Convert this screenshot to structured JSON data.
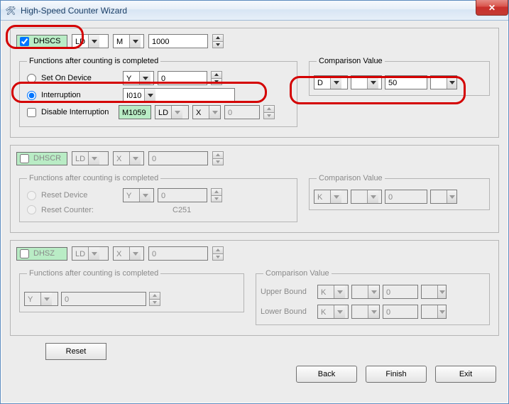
{
  "window": {
    "title": "High-Speed Counter Wizard",
    "close_glyph": "✕"
  },
  "buttons": {
    "reset": "Reset",
    "back": "Back",
    "finish": "Finish",
    "exit": "Exit"
  },
  "dhscs": {
    "label": "DHSCS",
    "checked": true,
    "op": "LD",
    "dev": "M",
    "num": "1000",
    "functions_legend": "Functions after counting is completed",
    "set_on_device": {
      "label": "Set On Device",
      "dev": "Y",
      "num": "0",
      "selected": false
    },
    "interruption": {
      "label": "Interruption",
      "val": "I010",
      "selected": true
    },
    "disable": {
      "label": "Disable Interruption",
      "tag": "M1059",
      "op": "LD",
      "dev": "X",
      "num": "0",
      "checked": false
    },
    "comparison_legend": "Comparison Value",
    "comparison": {
      "dev": "D",
      "idx": "",
      "num": "50"
    }
  },
  "dhscr": {
    "label": "DHSCR",
    "checked": false,
    "op": "LD",
    "dev": "X",
    "num": "0",
    "functions_legend": "Functions after counting is completed",
    "reset_device": {
      "label": "Reset Device",
      "dev": "Y",
      "num": "0"
    },
    "reset_counter": {
      "label": "Reset Counter:",
      "val": "C251"
    },
    "comparison_legend": "Comparison Value",
    "comparison": {
      "dev": "K",
      "idx": "",
      "num": "0"
    }
  },
  "dhsz": {
    "label": "DHSZ",
    "checked": false,
    "op": "LD",
    "dev": "X",
    "num": "0",
    "functions_legend": "Functions after counting is completed",
    "out": {
      "dev": "Y",
      "num": "0"
    },
    "comparison_legend": "Comparison Value",
    "upper": {
      "label": "Upper Bound",
      "dev": "K",
      "idx": "",
      "num": "0"
    },
    "lower": {
      "label": "Lower Bound",
      "dev": "K",
      "idx": "",
      "num": "0"
    }
  }
}
